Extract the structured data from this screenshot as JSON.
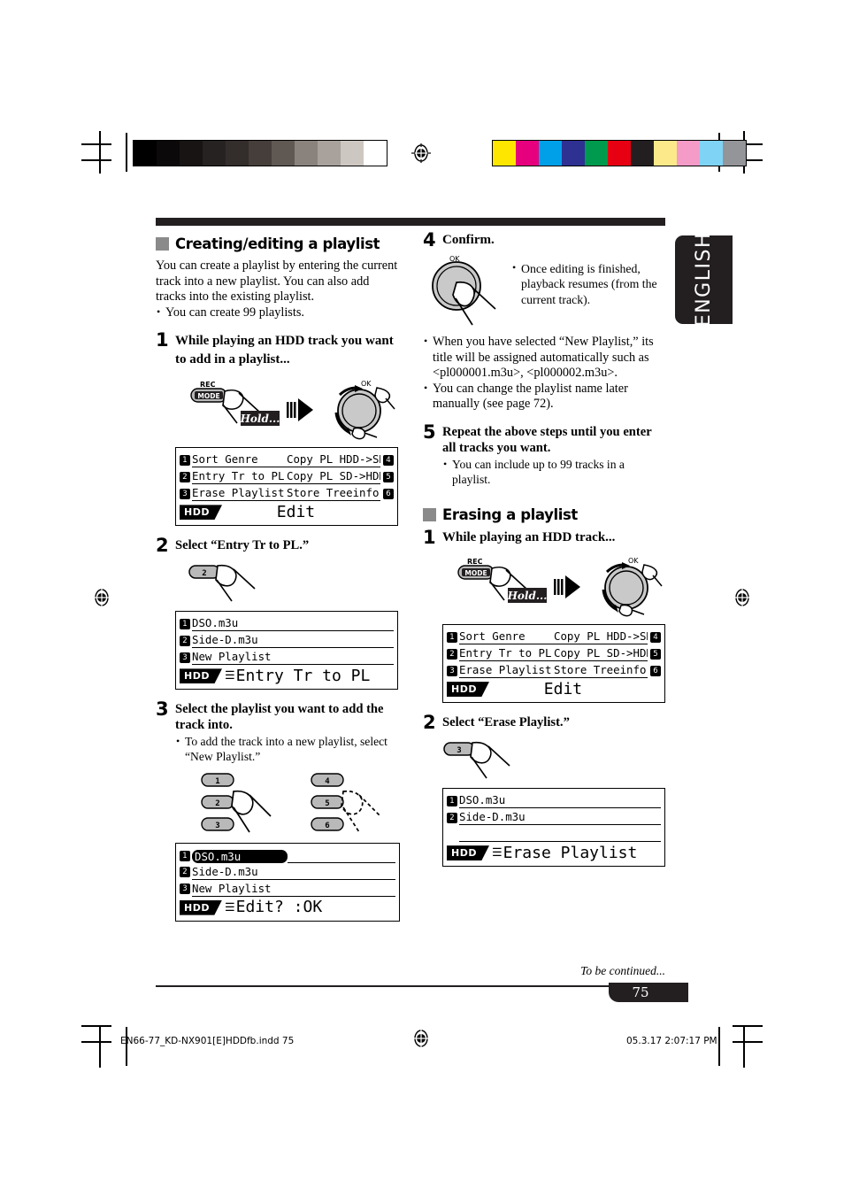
{
  "meta": {
    "language_tab": "ENGLISH",
    "page_number": "75",
    "to_be_continued": "To be continued...",
    "footer_file": "EN66-77_KD-NX901[E]HDDfb.indd   75",
    "footer_timestamp": "05.3.17   2:07:17 PM"
  },
  "print_marks": {
    "gray_ramp": [
      "#000000",
      "#0b0909",
      "#181414",
      "#272222",
      "#332d2b",
      "#453e3a",
      "#5f5853",
      "#8a837d",
      "#a9a29c",
      "#cdc7c2",
      "#ffffff"
    ],
    "color_bar": [
      "#ffe600",
      "#e6007e",
      "#00a0e9",
      "#2e3192",
      "#009a4e",
      "#e60012",
      "#231f20",
      "#fbe98a",
      "#f59bc8",
      "#7fd4f5",
      "#939598"
    ]
  },
  "left_column": {
    "section": {
      "title": "Creating/editing a playlist",
      "intro": "You can create a playlist by entering the current track into a new playlist. You can also add tracks into the existing playlist.",
      "bullets": [
        "You can create 99 playlists."
      ]
    },
    "step1": {
      "num": "1",
      "title": "While playing an HDD track you want to add in a playlist...",
      "rec_label_top": "REC",
      "rec_label_bottom": "MODE",
      "hold_label": "Hold...",
      "knob_label": "OK"
    },
    "lcd_edit": {
      "rows": [
        {
          "left_badge": "1",
          "left_text": "Sort Genre",
          "right_text": "Copy PL HDD->SD",
          "right_badge": "4"
        },
        {
          "left_badge": "2",
          "left_text": "Entry Tr to PL",
          "right_text": "Copy PL SD->HDD",
          "right_badge": "5"
        },
        {
          "left_badge": "3",
          "left_text": "Erase Playlist",
          "right_text": "Store Treeinfo",
          "right_badge": "6"
        }
      ],
      "tag": "HDD",
      "title": "Edit",
      "title_icon": ""
    },
    "step2": {
      "num": "2",
      "title": "Select “Entry Tr to PL.”",
      "button_label": "2"
    },
    "lcd_entry": {
      "rows": [
        {
          "left_badge": "1",
          "left_text": "DSO.m3u",
          "right_text": "",
          "right_badge": ""
        },
        {
          "left_badge": "2",
          "left_text": "Side-D.m3u",
          "right_text": "",
          "right_badge": ""
        },
        {
          "left_badge": "3",
          "left_text": "New Playlist",
          "right_text": "",
          "right_badge": ""
        }
      ],
      "tag": "HDD",
      "title": "Entry Tr to PL",
      "title_icon": "☰"
    },
    "step3": {
      "num": "3",
      "title": "Select the playlist you want to add the track into.",
      "bullets": [
        "To add the track into a new playlist, select “New Playlist.”"
      ],
      "buttons": [
        "1",
        "2",
        "3",
        "4",
        "5",
        "6"
      ],
      "finger_solid_on": "2",
      "finger_dashed_on": "5"
    },
    "lcd_editok": {
      "rows": [
        {
          "left_badge": "1",
          "left_text": "DSO.m3u",
          "selected": true,
          "right_text": "",
          "right_badge": ""
        },
        {
          "left_badge": "2",
          "left_text": "Side-D.m3u",
          "right_text": "",
          "right_badge": ""
        },
        {
          "left_badge": "3",
          "left_text": "New Playlist",
          "right_text": "",
          "right_badge": ""
        }
      ],
      "tag": "HDD",
      "title": "Edit? :OK",
      "title_icon": "☰"
    }
  },
  "right_column": {
    "step4": {
      "num": "4",
      "title": "Confirm.",
      "knob_label": "OK",
      "side_bullets": [
        "Once editing is finished, playback resumes (from the current track)."
      ],
      "bullets": [
        "When you have selected “New Playlist,” its title will be assigned automatically such as <pl000001.m3u>, <pl000002.m3u>.",
        "You can change the playlist name later manually (see page 72)."
      ]
    },
    "step5": {
      "num": "5",
      "title": "Repeat the above steps until you enter all tracks you want.",
      "bullets": [
        "You can include up to 99 tracks in a playlist."
      ]
    },
    "section": {
      "title": "Erasing a playlist"
    },
    "step1": {
      "num": "1",
      "title": "While playing an HDD track...",
      "rec_label_top": "REC",
      "rec_label_bottom": "MODE",
      "hold_label": "Hold...",
      "knob_label": "OK"
    },
    "lcd_edit": {
      "rows": [
        {
          "left_badge": "1",
          "left_text": "Sort Genre",
          "right_text": "Copy PL HDD->SD",
          "right_badge": "4"
        },
        {
          "left_badge": "2",
          "left_text": "Entry Tr to PL",
          "right_text": "Copy PL SD->HDD",
          "right_badge": "5"
        },
        {
          "left_badge": "3",
          "left_text": "Erase Playlist",
          "right_text": "Store Treeinfo",
          "right_badge": "6"
        }
      ],
      "tag": "HDD",
      "title": "Edit",
      "title_icon": ""
    },
    "step2": {
      "num": "2",
      "title": "Select “Erase Playlist.”",
      "button_label": "3"
    },
    "lcd_erase": {
      "rows": [
        {
          "left_badge": "1",
          "left_text": "DSO.m3u",
          "right_text": "",
          "right_badge": ""
        },
        {
          "left_badge": "2",
          "left_text": "Side-D.m3u",
          "right_text": "",
          "right_badge": ""
        },
        {
          "left_badge": "",
          "left_text": "",
          "right_text": "",
          "right_badge": ""
        }
      ],
      "tag": "HDD",
      "title": "Erase Playlist",
      "title_icon": "☰"
    }
  }
}
